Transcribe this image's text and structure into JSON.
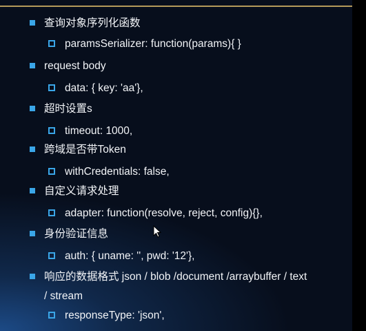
{
  "slide": {
    "items": [
      {
        "level": 1,
        "text": "查询对象序列化函数"
      },
      {
        "level": 2,
        "text": "paramsSerializer: function(params){ }"
      },
      {
        "level": 1,
        "text": "request body"
      },
      {
        "level": 2,
        "text": "data: { key: 'aa'},"
      },
      {
        "level": 1,
        "text": "超时设置s"
      },
      {
        "level": 2,
        "text": "timeout: 1000,"
      },
      {
        "level": 1,
        "text": "跨域是否带Token"
      },
      {
        "level": 2,
        "text": "withCredentials: false,"
      },
      {
        "level": 1,
        "text": "自定义请求处理"
      },
      {
        "level": 2,
        "text": "adapter: function(resolve, reject, config){},"
      },
      {
        "level": 1,
        "text": "身份验证信息"
      },
      {
        "level": 2,
        "text": "auth: { uname: '', pwd: '12'},"
      },
      {
        "level": 1,
        "text": "响应的数据格式 json / blob /document /arraybuffer / text"
      },
      {
        "level": 1,
        "text": "/ stream",
        "continuation": true
      },
      {
        "level": 2,
        "text": "responseType: 'json',"
      }
    ],
    "colors": {
      "bullet": "#3aa6e8",
      "rule": "#b59a5a",
      "text": "#f2f4f7",
      "background": "#070e1c"
    }
  },
  "cursor": "arrow-pointer-icon"
}
